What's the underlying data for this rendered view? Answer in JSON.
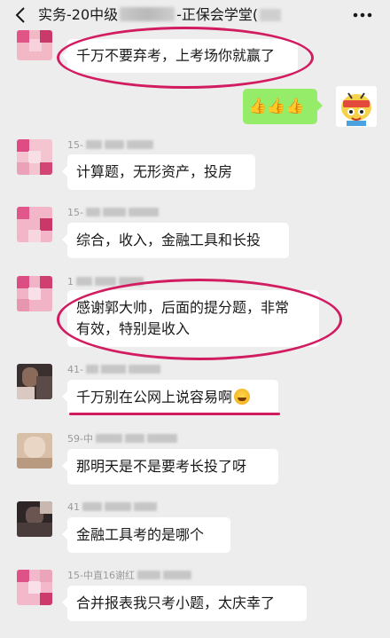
{
  "header": {
    "title_prefix": "实务-20中级",
    "title_suffix": "-正保会学堂("
  },
  "messages": [
    {
      "text": "千万不要弃考，上考场你就赢了"
    },
    {
      "text": "👍👍👍"
    },
    {
      "sender": "15-",
      "text": "计算题，无形资产，投房"
    },
    {
      "sender": "15-",
      "text": "综合，收入，金融工具和长投"
    },
    {
      "sender": "1",
      "line1": "感谢郭大帅，后面的提分题，非常",
      "line2": "有效，特别是收入"
    },
    {
      "sender": "41-",
      "text": "千万别在公网上说容易啊"
    },
    {
      "sender": "59-中",
      "text": "那明天是不是要考长投了呀"
    },
    {
      "sender": "41",
      "text": "金融工具考的是哪个"
    },
    {
      "sender": "15-中直16谢红",
      "text": "合并报表我只考小题，太庆幸了"
    }
  ],
  "colors": {
    "background": "#ededed",
    "bubble": "#ffffff",
    "self_bubble": "#95ec69",
    "highlight": "#d21c61"
  }
}
